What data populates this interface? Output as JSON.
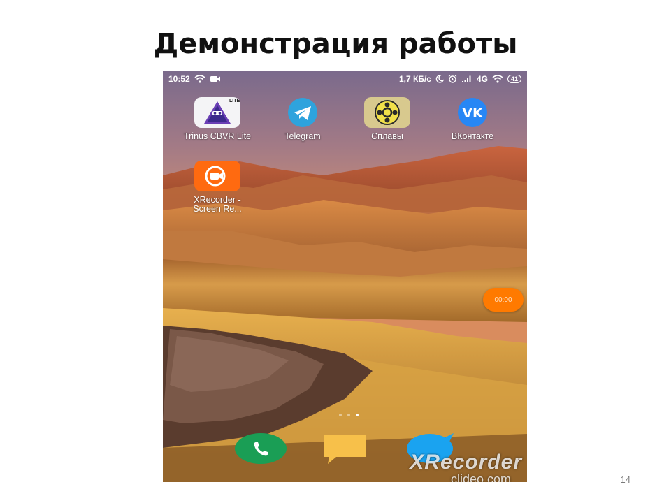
{
  "slide": {
    "title": "Демонстрация работы",
    "page_number": "14"
  },
  "status_bar": {
    "time": "10:52",
    "network_speed": "1,7 КБ/с",
    "network_type": "4G",
    "battery": "41",
    "icons_left": [
      "wifi-icon",
      "video-camera-icon"
    ],
    "icons_right": [
      "moon-icon",
      "alarm-icon",
      "signal-icon",
      "wifi-icon",
      "battery-icon"
    ]
  },
  "apps": [
    {
      "id": "trinus",
      "label": "Trinus CBVR Lite",
      "badge": "LITE",
      "icon": "trinus-vr-icon"
    },
    {
      "id": "telegram",
      "label": "Telegram",
      "icon": "telegram-icon"
    },
    {
      "id": "splavy",
      "label": "Сплавы",
      "icon": "splavy-icon"
    },
    {
      "id": "vk",
      "label": "ВКонтакте",
      "icon": "vk-icon",
      "glyph": "VK"
    },
    {
      "id": "xrecorder",
      "label": "XRecorder - Screen Re...",
      "icon": "xrecorder-icon"
    }
  ],
  "recorder_bubble": {
    "text": "00:00"
  },
  "page_indicator": {
    "count": 3,
    "active": 3
  },
  "dock": [
    {
      "id": "phone",
      "icon": "phone-icon",
      "color": "#1a9e55"
    },
    {
      "id": "messages",
      "icon": "messages-icon",
      "color": "#f7c04a"
    },
    {
      "id": "browser",
      "icon": "browser-icon",
      "color": "#1aa3f0"
    }
  ],
  "watermark": {
    "brand": "XRecorder",
    "site": "clideo.com"
  }
}
